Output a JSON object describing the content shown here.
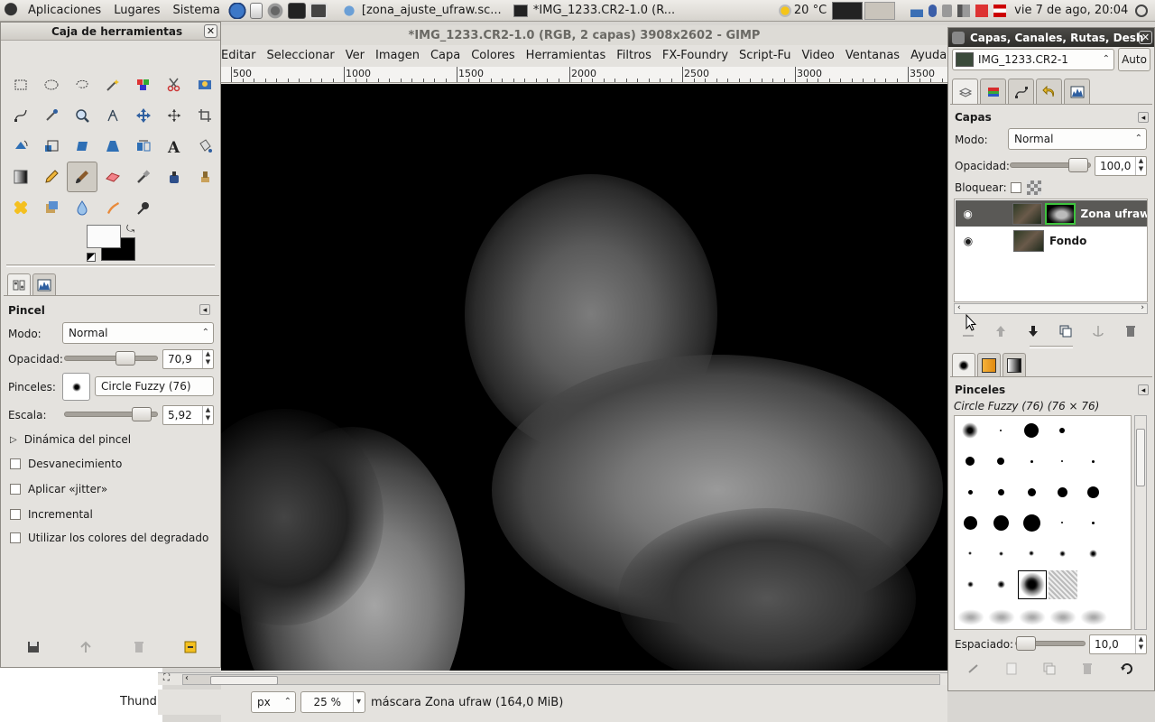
{
  "top_panel": {
    "menus": [
      "Aplicaciones",
      "Lugares",
      "Sistema"
    ],
    "tasks": [
      "[zona_ajuste_ufraw.sc...",
      "*IMG_1233.CR2-1.0 (R..."
    ],
    "weather": "20 °C",
    "clock": "vie  7 de ago, 20:04"
  },
  "toolbox": {
    "title": "Caja de herramientas",
    "tools": [
      "rect-select-icon",
      "ellipse-select-icon",
      "lasso-icon",
      "magic-wand-icon",
      "color-select-icon",
      "scissors-icon",
      "foreground-select-icon",
      "paths-icon",
      "color-picker-icon",
      "zoom-icon",
      "measure-icon",
      "move-icon",
      "align-icon",
      "crop-icon",
      "rotate-icon",
      "scale-icon",
      "shear-icon",
      "perspective-icon",
      "flip-icon",
      "text-icon",
      "bucket-fill-icon",
      "blend-icon",
      "pencil-icon",
      "paintbrush-icon",
      "eraser-icon",
      "airbrush-icon",
      "ink-icon",
      "clone-icon",
      "heal-icon",
      "perspective-clone-icon",
      "blur-icon",
      "smudge-icon",
      "dodge-burn-icon"
    ],
    "active_tool_index": 23,
    "fg_color": "#fbfbfb",
    "bg_color": "#000000"
  },
  "tool_options": {
    "title": "Pincel",
    "mode_label": "Modo:",
    "mode_value": "Normal",
    "opacity_label": "Opacidad:",
    "opacity_value": "70,9",
    "opacity_fraction": 0.709,
    "brushes_label": "Pinceles:",
    "brush_name": "Circle Fuzzy (76)",
    "scale_label": "Escala:",
    "scale_value": "5,92",
    "scale_fraction": 0.85,
    "dynamics_label": "Dinámica del pincel",
    "checks": [
      "Desvanecimiento",
      "Aplicar «jitter»",
      "Incremental",
      "Utilizar los colores del degradado"
    ]
  },
  "image_window": {
    "title": "*IMG_1233.CR2-1.0 (RGB, 2 capas) 3908x2602 - GIMP",
    "menus": [
      "Editar",
      "Seleccionar",
      "Ver",
      "Imagen",
      "Capa",
      "Colores",
      "Herramientas",
      "Filtros",
      "FX-Foundry",
      "Script-Fu",
      "Video",
      "Ventanas",
      "Ayuda"
    ],
    "ruler_labels": [
      "500",
      "1000",
      "1500",
      "2000",
      "2500",
      "3000",
      "3500"
    ],
    "unit": "px",
    "zoom": "25 %",
    "status": "máscara Zona ufraw  (164,0 MiB)",
    "behind_text": "Thund"
  },
  "dock": {
    "title": "Capas, Canales, Rutas, Desh",
    "image_select": "IMG_1233.CR2-1",
    "auto_label": "Auto",
    "layers_title": "Capas",
    "mode_label": "Modo:",
    "mode_value": "Normal",
    "opacity_label": "Opacidad:",
    "opacity_value": "100,0",
    "lock_label": "Bloquear:",
    "layers": [
      {
        "name": "Zona ufraw",
        "selected": true
      },
      {
        "name": "Fondo",
        "selected": false
      }
    ],
    "brushes_title": "Pinceles",
    "brush_info": "Circle Fuzzy (76) (76 × 76)",
    "spacing_label": "Espaciado:",
    "spacing_value": "10,0"
  },
  "colors": {
    "canvas_bg": "#000000",
    "selected_layer_bg": "#5a5956",
    "mask_border": "#3ec43e"
  }
}
